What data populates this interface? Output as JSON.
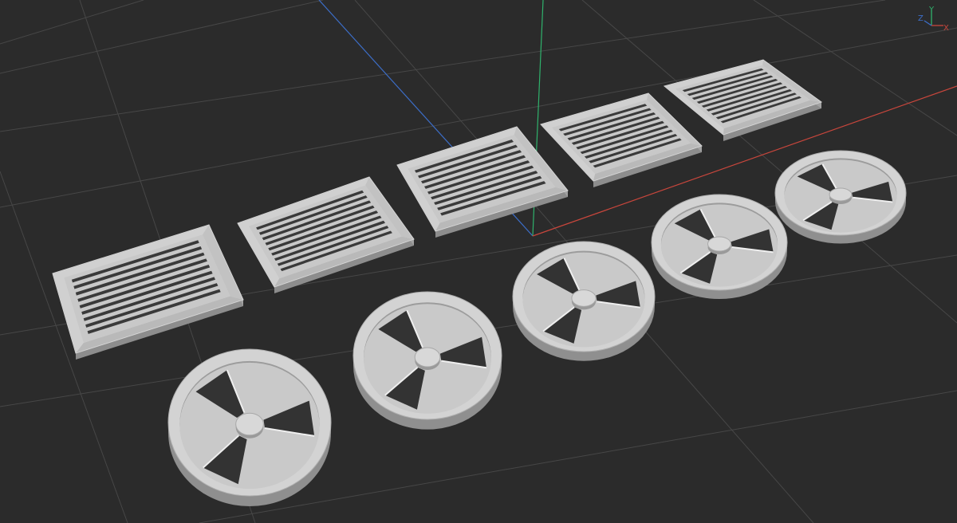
{
  "viewport": {
    "background": "#2b2b2b",
    "grid_color": "#4a4a4a",
    "axis_colors": {
      "x": "#c8463c",
      "y": "#2fb26c",
      "z": "#3c6ec8"
    },
    "model_color": "#c9c9c9"
  },
  "gizmo": {
    "x_label": "X",
    "y_label": "Y",
    "z_label": "Z"
  },
  "scene": {
    "objects": [
      {
        "type": "rectangular-vent-grille",
        "slats": 9
      },
      {
        "type": "rectangular-vent-grille",
        "slats": 9
      },
      {
        "type": "rectangular-vent-grille",
        "slats": 9
      },
      {
        "type": "rectangular-vent-grille",
        "slats": 9
      },
      {
        "type": "rectangular-vent-grille",
        "slats": 9
      },
      {
        "type": "round-fan-vent",
        "blades": 3
      },
      {
        "type": "round-fan-vent",
        "blades": 3
      },
      {
        "type": "round-fan-vent",
        "blades": 3
      },
      {
        "type": "round-fan-vent",
        "blades": 3
      },
      {
        "type": "round-fan-vent",
        "blades": 3
      }
    ]
  }
}
